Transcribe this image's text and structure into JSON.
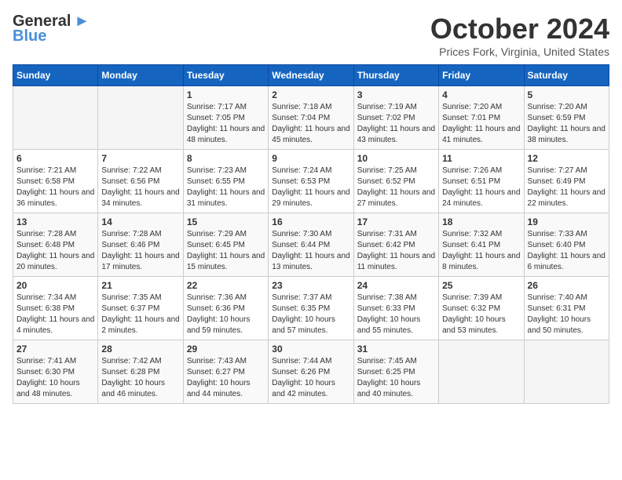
{
  "header": {
    "logo_line1": "General",
    "logo_line2": "Blue",
    "month": "October 2024",
    "location": "Prices Fork, Virginia, United States"
  },
  "days_of_week": [
    "Sunday",
    "Monday",
    "Tuesday",
    "Wednesday",
    "Thursday",
    "Friday",
    "Saturday"
  ],
  "weeks": [
    [
      {
        "day": "",
        "info": ""
      },
      {
        "day": "",
        "info": ""
      },
      {
        "day": "1",
        "info": "Sunrise: 7:17 AM\nSunset: 7:05 PM\nDaylight: 11 hours and 48 minutes."
      },
      {
        "day": "2",
        "info": "Sunrise: 7:18 AM\nSunset: 7:04 PM\nDaylight: 11 hours and 45 minutes."
      },
      {
        "day": "3",
        "info": "Sunrise: 7:19 AM\nSunset: 7:02 PM\nDaylight: 11 hours and 43 minutes."
      },
      {
        "day": "4",
        "info": "Sunrise: 7:20 AM\nSunset: 7:01 PM\nDaylight: 11 hours and 41 minutes."
      },
      {
        "day": "5",
        "info": "Sunrise: 7:20 AM\nSunset: 6:59 PM\nDaylight: 11 hours and 38 minutes."
      }
    ],
    [
      {
        "day": "6",
        "info": "Sunrise: 7:21 AM\nSunset: 6:58 PM\nDaylight: 11 hours and 36 minutes."
      },
      {
        "day": "7",
        "info": "Sunrise: 7:22 AM\nSunset: 6:56 PM\nDaylight: 11 hours and 34 minutes."
      },
      {
        "day": "8",
        "info": "Sunrise: 7:23 AM\nSunset: 6:55 PM\nDaylight: 11 hours and 31 minutes."
      },
      {
        "day": "9",
        "info": "Sunrise: 7:24 AM\nSunset: 6:53 PM\nDaylight: 11 hours and 29 minutes."
      },
      {
        "day": "10",
        "info": "Sunrise: 7:25 AM\nSunset: 6:52 PM\nDaylight: 11 hours and 27 minutes."
      },
      {
        "day": "11",
        "info": "Sunrise: 7:26 AM\nSunset: 6:51 PM\nDaylight: 11 hours and 24 minutes."
      },
      {
        "day": "12",
        "info": "Sunrise: 7:27 AM\nSunset: 6:49 PM\nDaylight: 11 hours and 22 minutes."
      }
    ],
    [
      {
        "day": "13",
        "info": "Sunrise: 7:28 AM\nSunset: 6:48 PM\nDaylight: 11 hours and 20 minutes."
      },
      {
        "day": "14",
        "info": "Sunrise: 7:28 AM\nSunset: 6:46 PM\nDaylight: 11 hours and 17 minutes."
      },
      {
        "day": "15",
        "info": "Sunrise: 7:29 AM\nSunset: 6:45 PM\nDaylight: 11 hours and 15 minutes."
      },
      {
        "day": "16",
        "info": "Sunrise: 7:30 AM\nSunset: 6:44 PM\nDaylight: 11 hours and 13 minutes."
      },
      {
        "day": "17",
        "info": "Sunrise: 7:31 AM\nSunset: 6:42 PM\nDaylight: 11 hours and 11 minutes."
      },
      {
        "day": "18",
        "info": "Sunrise: 7:32 AM\nSunset: 6:41 PM\nDaylight: 11 hours and 8 minutes."
      },
      {
        "day": "19",
        "info": "Sunrise: 7:33 AM\nSunset: 6:40 PM\nDaylight: 11 hours and 6 minutes."
      }
    ],
    [
      {
        "day": "20",
        "info": "Sunrise: 7:34 AM\nSunset: 6:38 PM\nDaylight: 11 hours and 4 minutes."
      },
      {
        "day": "21",
        "info": "Sunrise: 7:35 AM\nSunset: 6:37 PM\nDaylight: 11 hours and 2 minutes."
      },
      {
        "day": "22",
        "info": "Sunrise: 7:36 AM\nSunset: 6:36 PM\nDaylight: 10 hours and 59 minutes."
      },
      {
        "day": "23",
        "info": "Sunrise: 7:37 AM\nSunset: 6:35 PM\nDaylight: 10 hours and 57 minutes."
      },
      {
        "day": "24",
        "info": "Sunrise: 7:38 AM\nSunset: 6:33 PM\nDaylight: 10 hours and 55 minutes."
      },
      {
        "day": "25",
        "info": "Sunrise: 7:39 AM\nSunset: 6:32 PM\nDaylight: 10 hours and 53 minutes."
      },
      {
        "day": "26",
        "info": "Sunrise: 7:40 AM\nSunset: 6:31 PM\nDaylight: 10 hours and 50 minutes."
      }
    ],
    [
      {
        "day": "27",
        "info": "Sunrise: 7:41 AM\nSunset: 6:30 PM\nDaylight: 10 hours and 48 minutes."
      },
      {
        "day": "28",
        "info": "Sunrise: 7:42 AM\nSunset: 6:28 PM\nDaylight: 10 hours and 46 minutes."
      },
      {
        "day": "29",
        "info": "Sunrise: 7:43 AM\nSunset: 6:27 PM\nDaylight: 10 hours and 44 minutes."
      },
      {
        "day": "30",
        "info": "Sunrise: 7:44 AM\nSunset: 6:26 PM\nDaylight: 10 hours and 42 minutes."
      },
      {
        "day": "31",
        "info": "Sunrise: 7:45 AM\nSunset: 6:25 PM\nDaylight: 10 hours and 40 minutes."
      },
      {
        "day": "",
        "info": ""
      },
      {
        "day": "",
        "info": ""
      }
    ]
  ]
}
